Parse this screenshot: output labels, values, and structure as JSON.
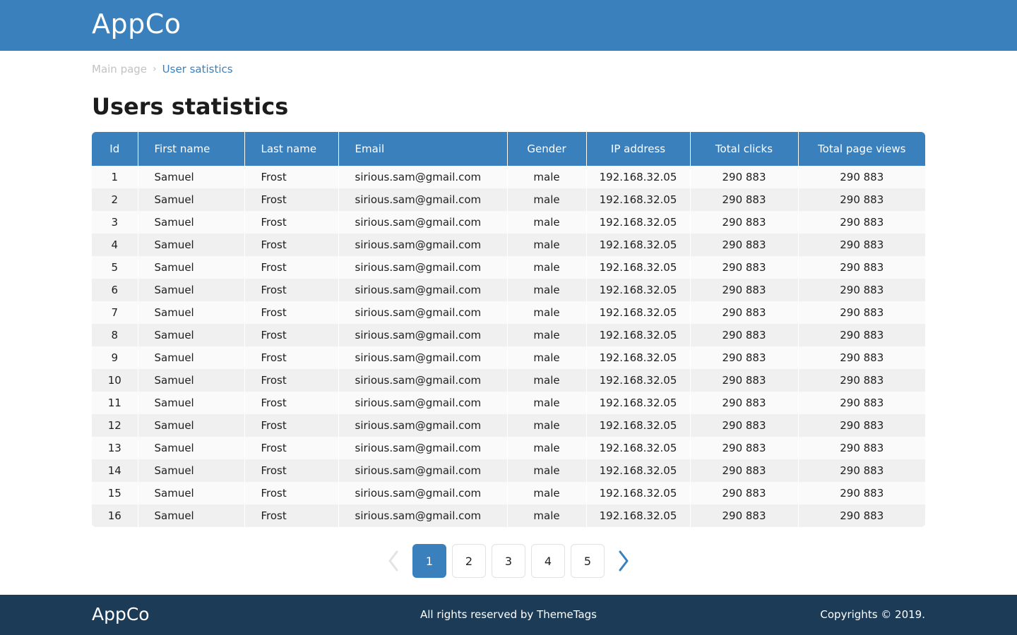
{
  "header": {
    "logo": "AppCo"
  },
  "breadcrumb": {
    "main": "Main page",
    "current": "User satistics"
  },
  "page": {
    "title": "Users statistics"
  },
  "table": {
    "columns": [
      "Id",
      "First name",
      "Last name",
      "Email",
      "Gender",
      "IP address",
      "Total clicks",
      "Total page views"
    ],
    "rows": [
      [
        "1",
        "Samuel",
        "Frost",
        "sirious.sam@gmail.com",
        "male",
        "192.168.32.05",
        "290 883",
        "290 883"
      ],
      [
        "2",
        "Samuel",
        "Frost",
        "sirious.sam@gmail.com",
        "male",
        "192.168.32.05",
        "290 883",
        "290 883"
      ],
      [
        "3",
        "Samuel",
        "Frost",
        "sirious.sam@gmail.com",
        "male",
        "192.168.32.05",
        "290 883",
        "290 883"
      ],
      [
        "4",
        "Samuel",
        "Frost",
        "sirious.sam@gmail.com",
        "male",
        "192.168.32.05",
        "290 883",
        "290 883"
      ],
      [
        "5",
        "Samuel",
        "Frost",
        "sirious.sam@gmail.com",
        "male",
        "192.168.32.05",
        "290 883",
        "290 883"
      ],
      [
        "6",
        "Samuel",
        "Frost",
        "sirious.sam@gmail.com",
        "male",
        "192.168.32.05",
        "290 883",
        "290 883"
      ],
      [
        "7",
        "Samuel",
        "Frost",
        "sirious.sam@gmail.com",
        "male",
        "192.168.32.05",
        "290 883",
        "290 883"
      ],
      [
        "8",
        "Samuel",
        "Frost",
        "sirious.sam@gmail.com",
        "male",
        "192.168.32.05",
        "290 883",
        "290 883"
      ],
      [
        "9",
        "Samuel",
        "Frost",
        "sirious.sam@gmail.com",
        "male",
        "192.168.32.05",
        "290 883",
        "290 883"
      ],
      [
        "10",
        "Samuel",
        "Frost",
        "sirious.sam@gmail.com",
        "male",
        "192.168.32.05",
        "290 883",
        "290 883"
      ],
      [
        "11",
        "Samuel",
        "Frost",
        "sirious.sam@gmail.com",
        "male",
        "192.168.32.05",
        "290 883",
        "290 883"
      ],
      [
        "12",
        "Samuel",
        "Frost",
        "sirious.sam@gmail.com",
        "male",
        "192.168.32.05",
        "290 883",
        "290 883"
      ],
      [
        "13",
        "Samuel",
        "Frost",
        "sirious.sam@gmail.com",
        "male",
        "192.168.32.05",
        "290 883",
        "290 883"
      ],
      [
        "14",
        "Samuel",
        "Frost",
        "sirious.sam@gmail.com",
        "male",
        "192.168.32.05",
        "290 883",
        "290 883"
      ],
      [
        "15",
        "Samuel",
        "Frost",
        "sirious.sam@gmail.com",
        "male",
        "192.168.32.05",
        "290 883",
        "290 883"
      ],
      [
        "16",
        "Samuel",
        "Frost",
        "sirious.sam@gmail.com",
        "male",
        "192.168.32.05",
        "290 883",
        "290 883"
      ]
    ]
  },
  "pagination": {
    "pages": [
      "1",
      "2",
      "3",
      "4",
      "5"
    ],
    "current": "1",
    "prev_icon": "chevron-left-icon",
    "next_icon": "chevron-right-icon"
  },
  "footer": {
    "logo": "AppCo",
    "rights": "All rights reserved by ThemeTags",
    "copyright": "Copyrights © 2019."
  },
  "colors": {
    "primary": "#3a80bd",
    "footer_bg": "#1c3b57",
    "row_odd": "#fafafa",
    "row_even": "#f0f0f0",
    "muted": "#c2c2c2"
  }
}
